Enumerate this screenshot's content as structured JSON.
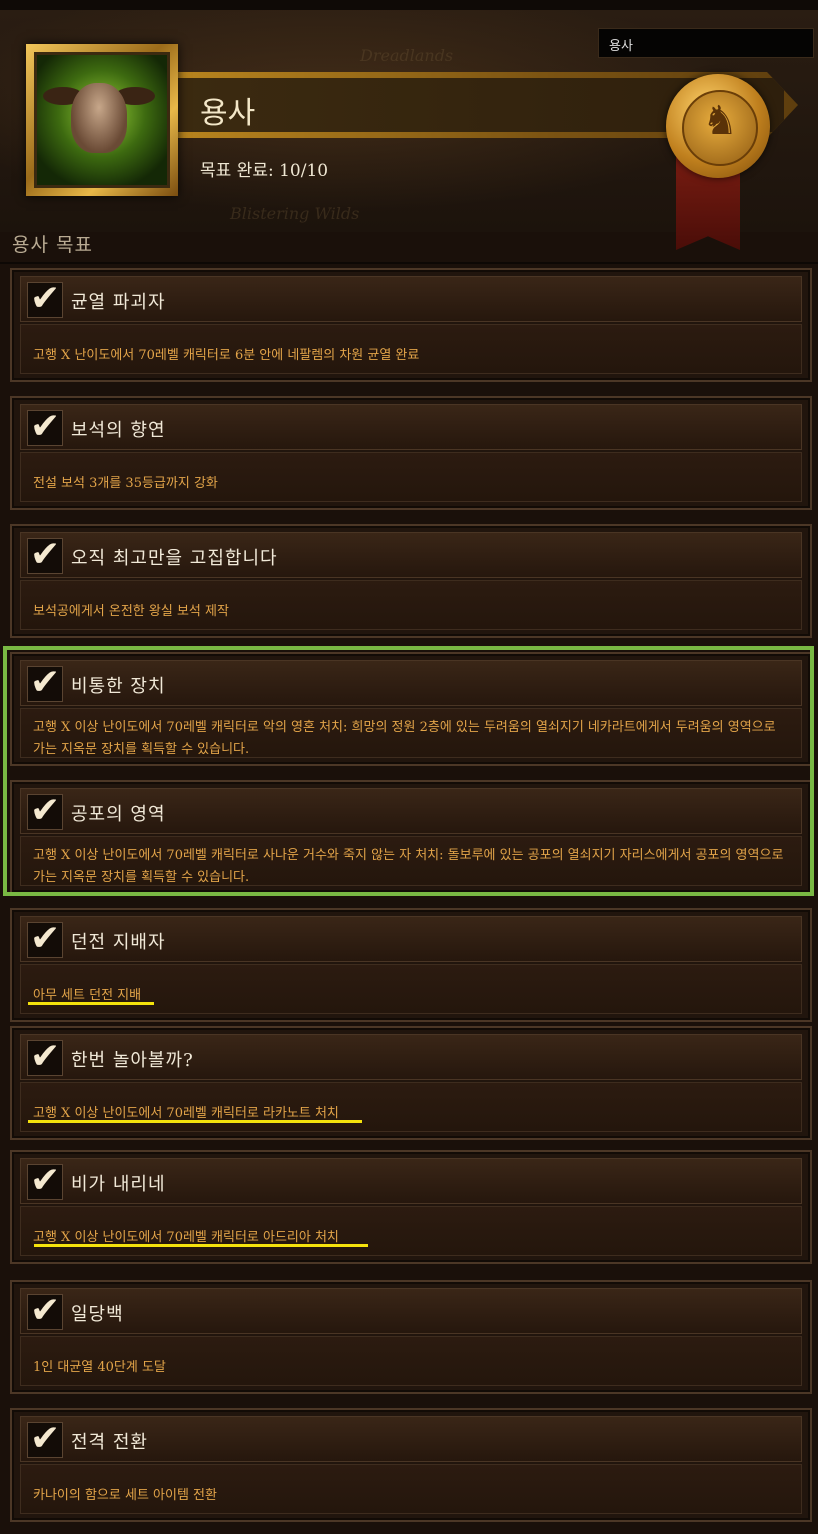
{
  "search": {
    "value": "용사"
  },
  "header": {
    "title": "용사",
    "progress_label": "목표 완료: 10/10",
    "map_labels": [
      "Dreadlands",
      "Blistering Wilds"
    ]
  },
  "section": {
    "title": "용사 목표"
  },
  "goals": [
    {
      "name": "균열 파괴자",
      "desc": "고행 X 난이도에서 70레벨 캐릭터로 6분 안에 네팔렘의 차원 균열 완료",
      "completed": true
    },
    {
      "name": "보석의 향연",
      "desc": "전설 보석 3개를 35등급까지 강화",
      "completed": true
    },
    {
      "name": "오직 최고만을 고집합니다",
      "desc": "보석공에게서 온전한 왕실 보석 제작",
      "completed": true
    },
    {
      "name": "비통한 장치",
      "desc": "고행 X 이상 난이도에서 70레벨 캐릭터로 악의 영혼 처치: 희망의 정원 2층에 있는 두려움의 열쇠지기 네카라트에게서 두려움의 영역으로 가는 지옥문 장치를 획득할 수 있습니다.",
      "completed": true
    },
    {
      "name": "공포의 영역",
      "desc": "고행 X 이상 난이도에서 70레벨 캐릭터로 사나운 거수와 죽지 않는 자 처치: 돌보루에 있는 공포의 열쇠지기 자리스에게서 공포의 영역으로 가는 지옥문 장치를 획득할 수 있습니다.",
      "completed": true
    },
    {
      "name": "던전 지배자",
      "desc": "아무 세트 던전 지배",
      "completed": true
    },
    {
      "name": "한번 놀아볼까?",
      "desc": "고행 X 이상 난이도에서 70레벨 캐릭터로 라카노트 처치",
      "completed": true
    },
    {
      "name": "비가 내리네",
      "desc": "고행 X 이상 난이도에서 70레벨 캐릭터로 아드리아 처치",
      "completed": true
    },
    {
      "name": "일당백",
      "desc": "1인 대균열 40단계 도달",
      "completed": true
    },
    {
      "name": "전격 전환",
      "desc": "카나이의 함으로 세트 아이템 전환",
      "completed": true
    }
  ],
  "check_glyph": "✔",
  "colors": {
    "desc_text": "#e2a449",
    "highlight_border": "#79b843",
    "underline": "#f4e20c"
  }
}
